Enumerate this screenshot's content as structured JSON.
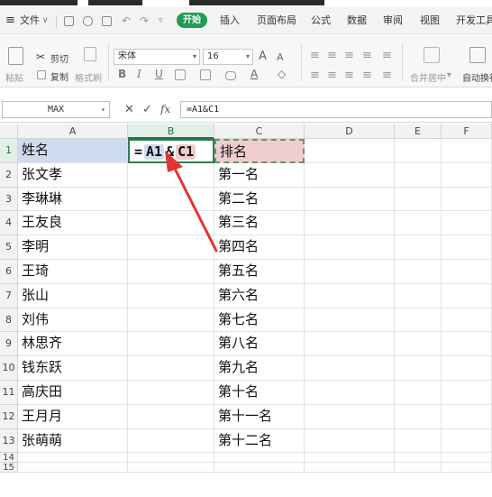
{
  "menu": {
    "app_menu": "文件",
    "tabs": [
      "开始",
      "插入",
      "页面布局",
      "公式",
      "数据",
      "审阅",
      "视图",
      "开发工具"
    ],
    "active_tab": "开始"
  },
  "ribbon": {
    "paste": "粘贴",
    "cut": "剪切",
    "copy": "复制",
    "format_painter": "格式刷",
    "font_name": "宋体",
    "font_size": "16",
    "bold": "B",
    "italic": "I",
    "underline": "U",
    "merge_center": "合并居中",
    "wrap_text": "自动换行"
  },
  "formula_bar": {
    "name_box": "MAX",
    "cancel_symbol": "✕",
    "confirm_symbol": "✓",
    "fx": "fx",
    "formula": "=A1&C1"
  },
  "sheet": {
    "columns": [
      "A",
      "B",
      "C",
      "D",
      "E",
      "F"
    ],
    "rows": [
      "1",
      "2",
      "3",
      "4",
      "5",
      "6",
      "7",
      "8",
      "9",
      "10",
      "11",
      "12",
      "13",
      "14",
      "15"
    ],
    "header_a1": "姓名",
    "header_c1": "排名",
    "formula_tokens": {
      "eq": "=",
      "ref1": "A1",
      "amp": "&",
      "ref2": "C1"
    },
    "names": [
      "张文孝",
      "李琳琳",
      "王友良",
      "李明",
      "王琦",
      "张山",
      "刘伟",
      "林思齐",
      "钱东跃",
      "高庆田",
      "王月月",
      "张萌萌"
    ],
    "ranks": [
      "第一名",
      "第二名",
      "第三名",
      "第四名",
      "第五名",
      "第六名",
      "第七名",
      "第八名",
      "第九名",
      "第十名",
      "第十一名",
      "第十二名"
    ]
  },
  "colors": {
    "accent_green": "#1e9c4f",
    "a1_fill": "#cfdcf0",
    "c1_fill": "#efcccd",
    "arrow_red": "#e53333"
  }
}
